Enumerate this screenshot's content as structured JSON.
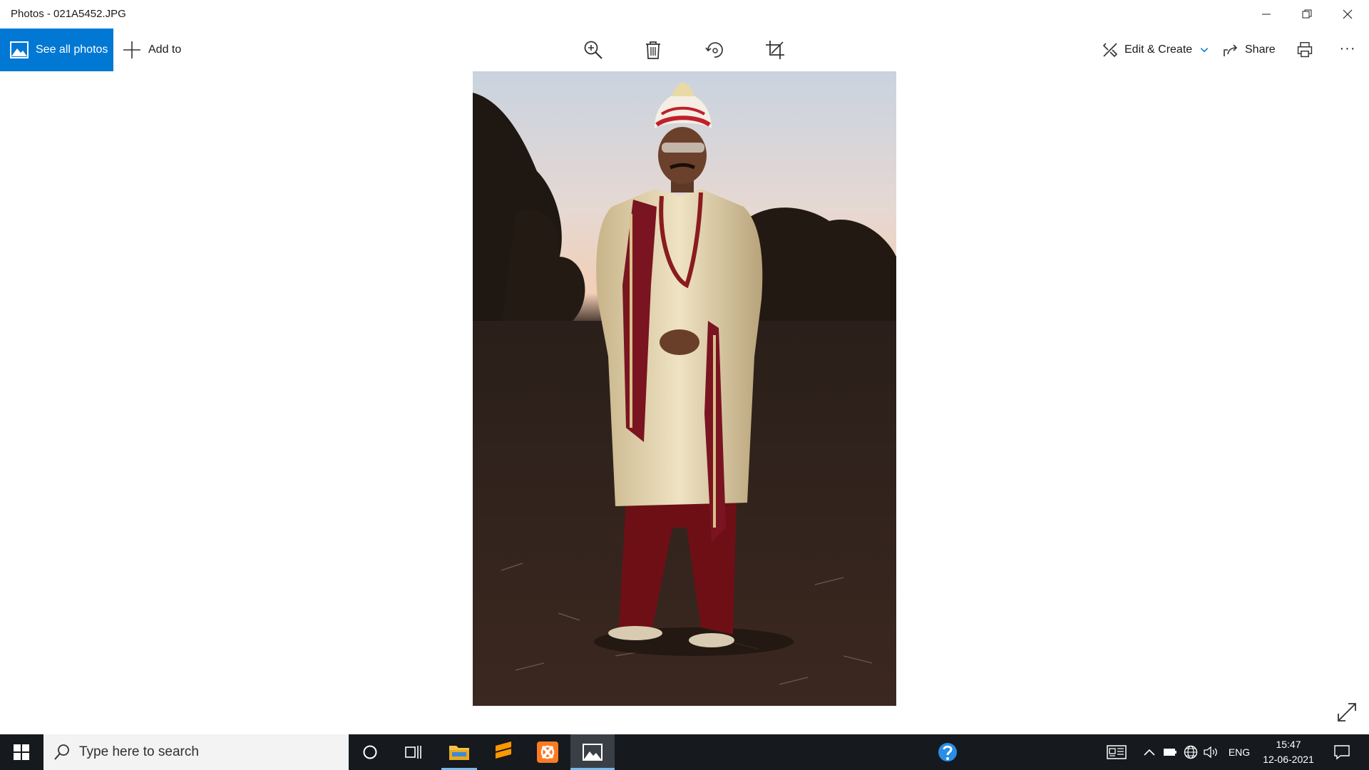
{
  "window": {
    "title": "Photos - 021A5452.JPG"
  },
  "commandbar": {
    "see_all_photos": "See all photos",
    "add_to": "Add to",
    "tools": [
      "zoom-in-icon",
      "delete-icon",
      "rotate-icon",
      "crop-icon"
    ],
    "edit_create": "Edit & Create",
    "share": "Share",
    "more": "···"
  },
  "photo": {
    "description_icon": "photo-of-groom-in-sherwani"
  },
  "taskbar": {
    "search_placeholder": "Type here to search",
    "language": "ENG",
    "time": "15:47",
    "date": "12-06-2021"
  },
  "colors": {
    "accent": "#0078d4",
    "taskbar": "#16191d"
  }
}
